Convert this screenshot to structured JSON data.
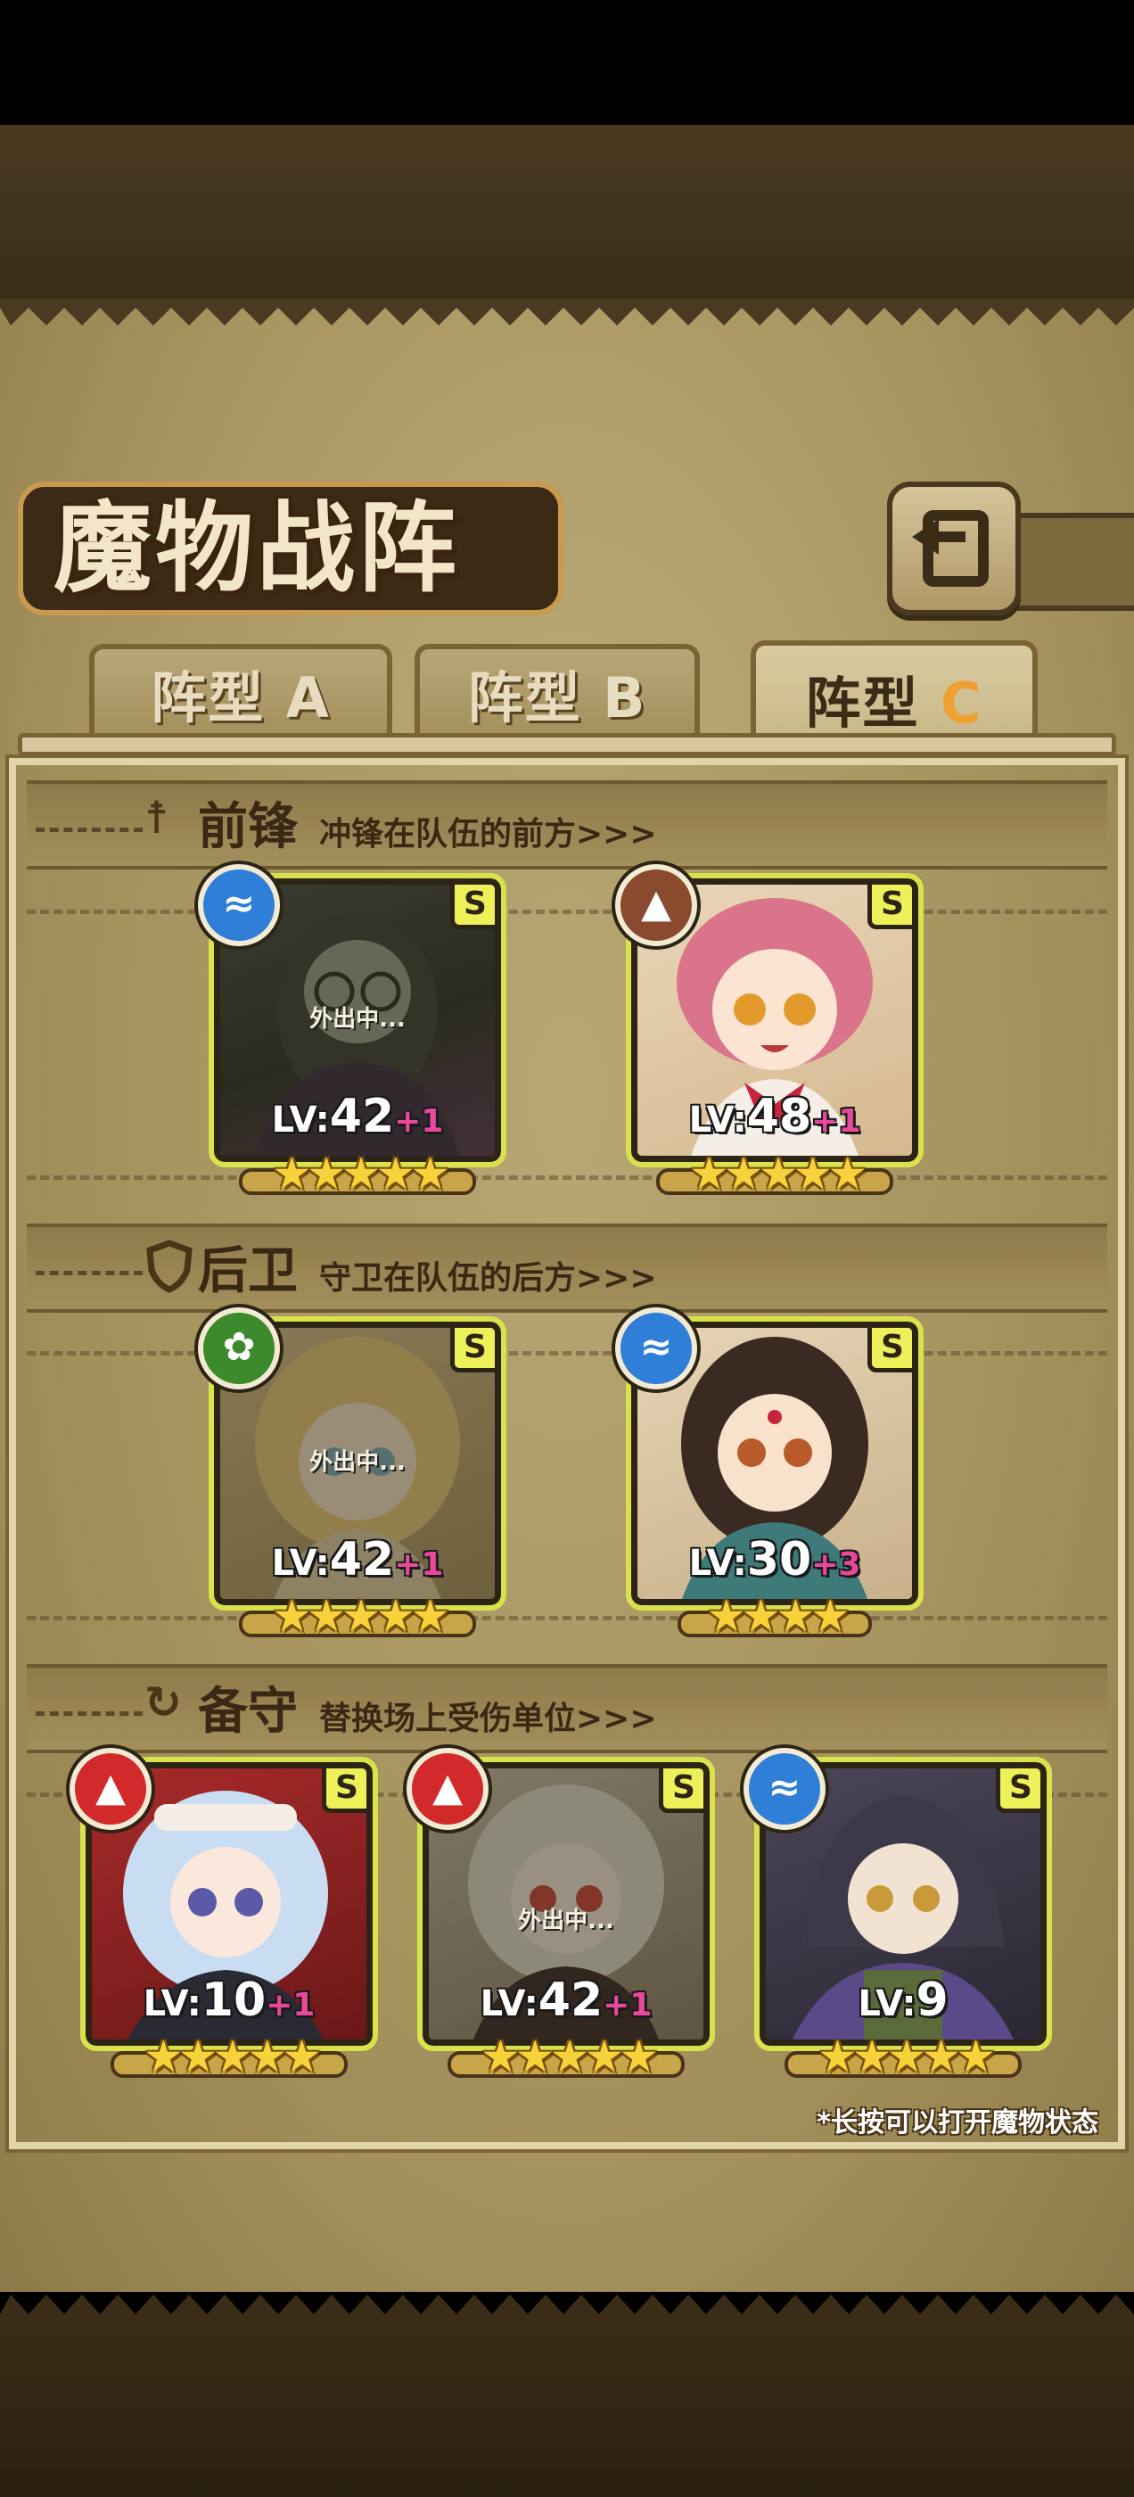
{
  "title": "魔物战阵",
  "tabs": [
    {
      "prefix": "阵型",
      "letter": "A",
      "active": false
    },
    {
      "prefix": "阵型",
      "letter": "B",
      "active": false
    },
    {
      "prefix": "阵型",
      "letter": "C",
      "active": true
    }
  ],
  "sections": [
    {
      "icon": "sword-icon",
      "title": "前锋",
      "desc": "冲锋在队伍的前方>>>",
      "units": [
        {
          "element": "water",
          "rank": "S",
          "status": "外出中...",
          "lv_prefix": "LV:",
          "level": "42",
          "bonus": "+1",
          "stars": "★★★★★"
        },
        {
          "element": "earth",
          "rank": "S",
          "status": "",
          "lv_prefix": "LV:",
          "level": "48",
          "bonus": "+1",
          "stars": "★★★★★"
        }
      ]
    },
    {
      "icon": "shield-icon",
      "title": "后卫",
      "desc": "守卫在队伍的后方>>>",
      "units": [
        {
          "element": "wood",
          "rank": "S",
          "status": "外出中...",
          "lv_prefix": "LV:",
          "level": "42",
          "bonus": "+1",
          "stars": "★★★★★"
        },
        {
          "element": "water",
          "rank": "S",
          "status": "",
          "lv_prefix": "LV:",
          "level": "30",
          "bonus": "+3",
          "stars": "★★★★"
        }
      ]
    },
    {
      "icon": "swap-icon",
      "title": "备守",
      "desc": "替换场上受伤单位>>>",
      "units": [
        {
          "element": "fire",
          "rank": "S",
          "status": "",
          "lv_prefix": "LV:",
          "level": "10",
          "bonus": "+1",
          "stars": "★★★★★"
        },
        {
          "element": "fire",
          "rank": "S",
          "status": "外出中...",
          "lv_prefix": "LV:",
          "level": "42",
          "bonus": "+1",
          "stars": "★★★★★"
        },
        {
          "element": "water",
          "rank": "S",
          "status": "",
          "lv_prefix": "LV:",
          "level": "9",
          "bonus": "",
          "stars": "★★★★★"
        }
      ]
    }
  ],
  "hint": "*长按可以打开魔物状态",
  "colors": {
    "parchment": "#b8a670",
    "frame": "#7b6434",
    "card_border": "#d9e24a",
    "bonus": "#e8499a",
    "star": "#f7d23a"
  }
}
